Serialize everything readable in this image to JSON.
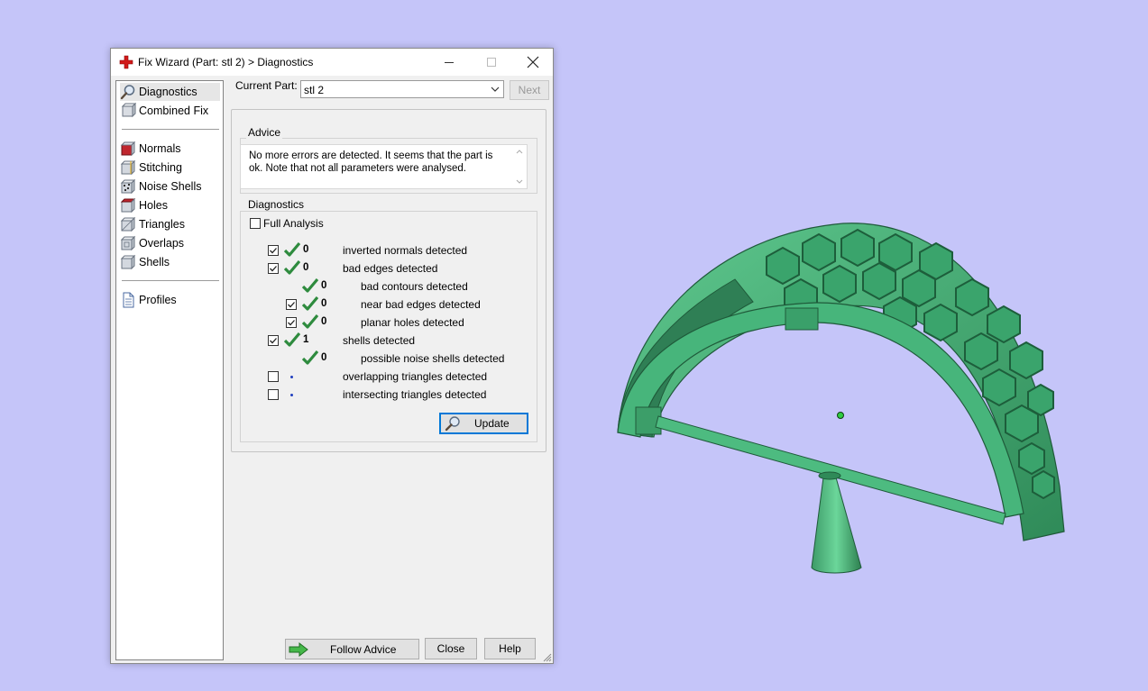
{
  "window": {
    "title": "Fix Wizard (Part: stl 2) > Diagnostics"
  },
  "sidebar": {
    "items": [
      {
        "label": "Diagnostics",
        "icon": "magnifier-icon",
        "selected": true
      },
      {
        "label": "Combined Fix",
        "icon": "combined-fix-icon"
      },
      {
        "label": "Normals",
        "icon": "normals-cube-icon"
      },
      {
        "label": "Stitching",
        "icon": "stitching-cube-icon"
      },
      {
        "label": "Noise Shells",
        "icon": "noise-shells-icon"
      },
      {
        "label": "Holes",
        "icon": "holes-cube-icon"
      },
      {
        "label": "Triangles",
        "icon": "triangles-cube-icon"
      },
      {
        "label": "Overlaps",
        "icon": "overlaps-cube-icon"
      },
      {
        "label": "Shells",
        "icon": "shells-cube-icon"
      },
      {
        "label": "Profiles",
        "icon": "document-icon"
      }
    ]
  },
  "header": {
    "current_part_label": "Current Part:",
    "current_part_value": "stl 2",
    "next_label": "Next"
  },
  "advice": {
    "title": "Advice",
    "text": "No more errors are detected. It seems that the part is ok. Note that not all parameters were analysed."
  },
  "diagnostics": {
    "title": "Diagnostics",
    "full_analysis_label": "Full Analysis",
    "rows": [
      {
        "checked": true,
        "status": "ok",
        "count": "0",
        "label": "inverted normals detected"
      },
      {
        "checked": true,
        "status": "ok",
        "count": "0",
        "label": "bad edges detected"
      },
      {
        "checked": null,
        "status": "ok",
        "count": "0",
        "label": "bad contours detected"
      },
      {
        "checked": true,
        "status": "ok",
        "count": "0",
        "label": "near bad edges detected"
      },
      {
        "checked": true,
        "status": "ok",
        "count": "0",
        "label": "planar holes detected"
      },
      {
        "checked": true,
        "status": "ok",
        "count": "1",
        "label": "shells detected"
      },
      {
        "checked": null,
        "status": "ok",
        "count": "0",
        "label": "possible noise shells detected"
      },
      {
        "checked": false,
        "status": "not-analysed",
        "count": "",
        "label": "overlapping triangles detected"
      },
      {
        "checked": false,
        "status": "not-analysed",
        "count": "",
        "label": "intersecting triangles detected"
      }
    ],
    "update_label": "Update"
  },
  "footer": {
    "follow_advice_label": "Follow Advice",
    "close_label": "Close",
    "help_label": "Help"
  },
  "colors": {
    "background": "#c5c5f9",
    "model_green": "#3fa46e",
    "check_green": "#2e8b3e",
    "selection_border": "#0078d7"
  }
}
